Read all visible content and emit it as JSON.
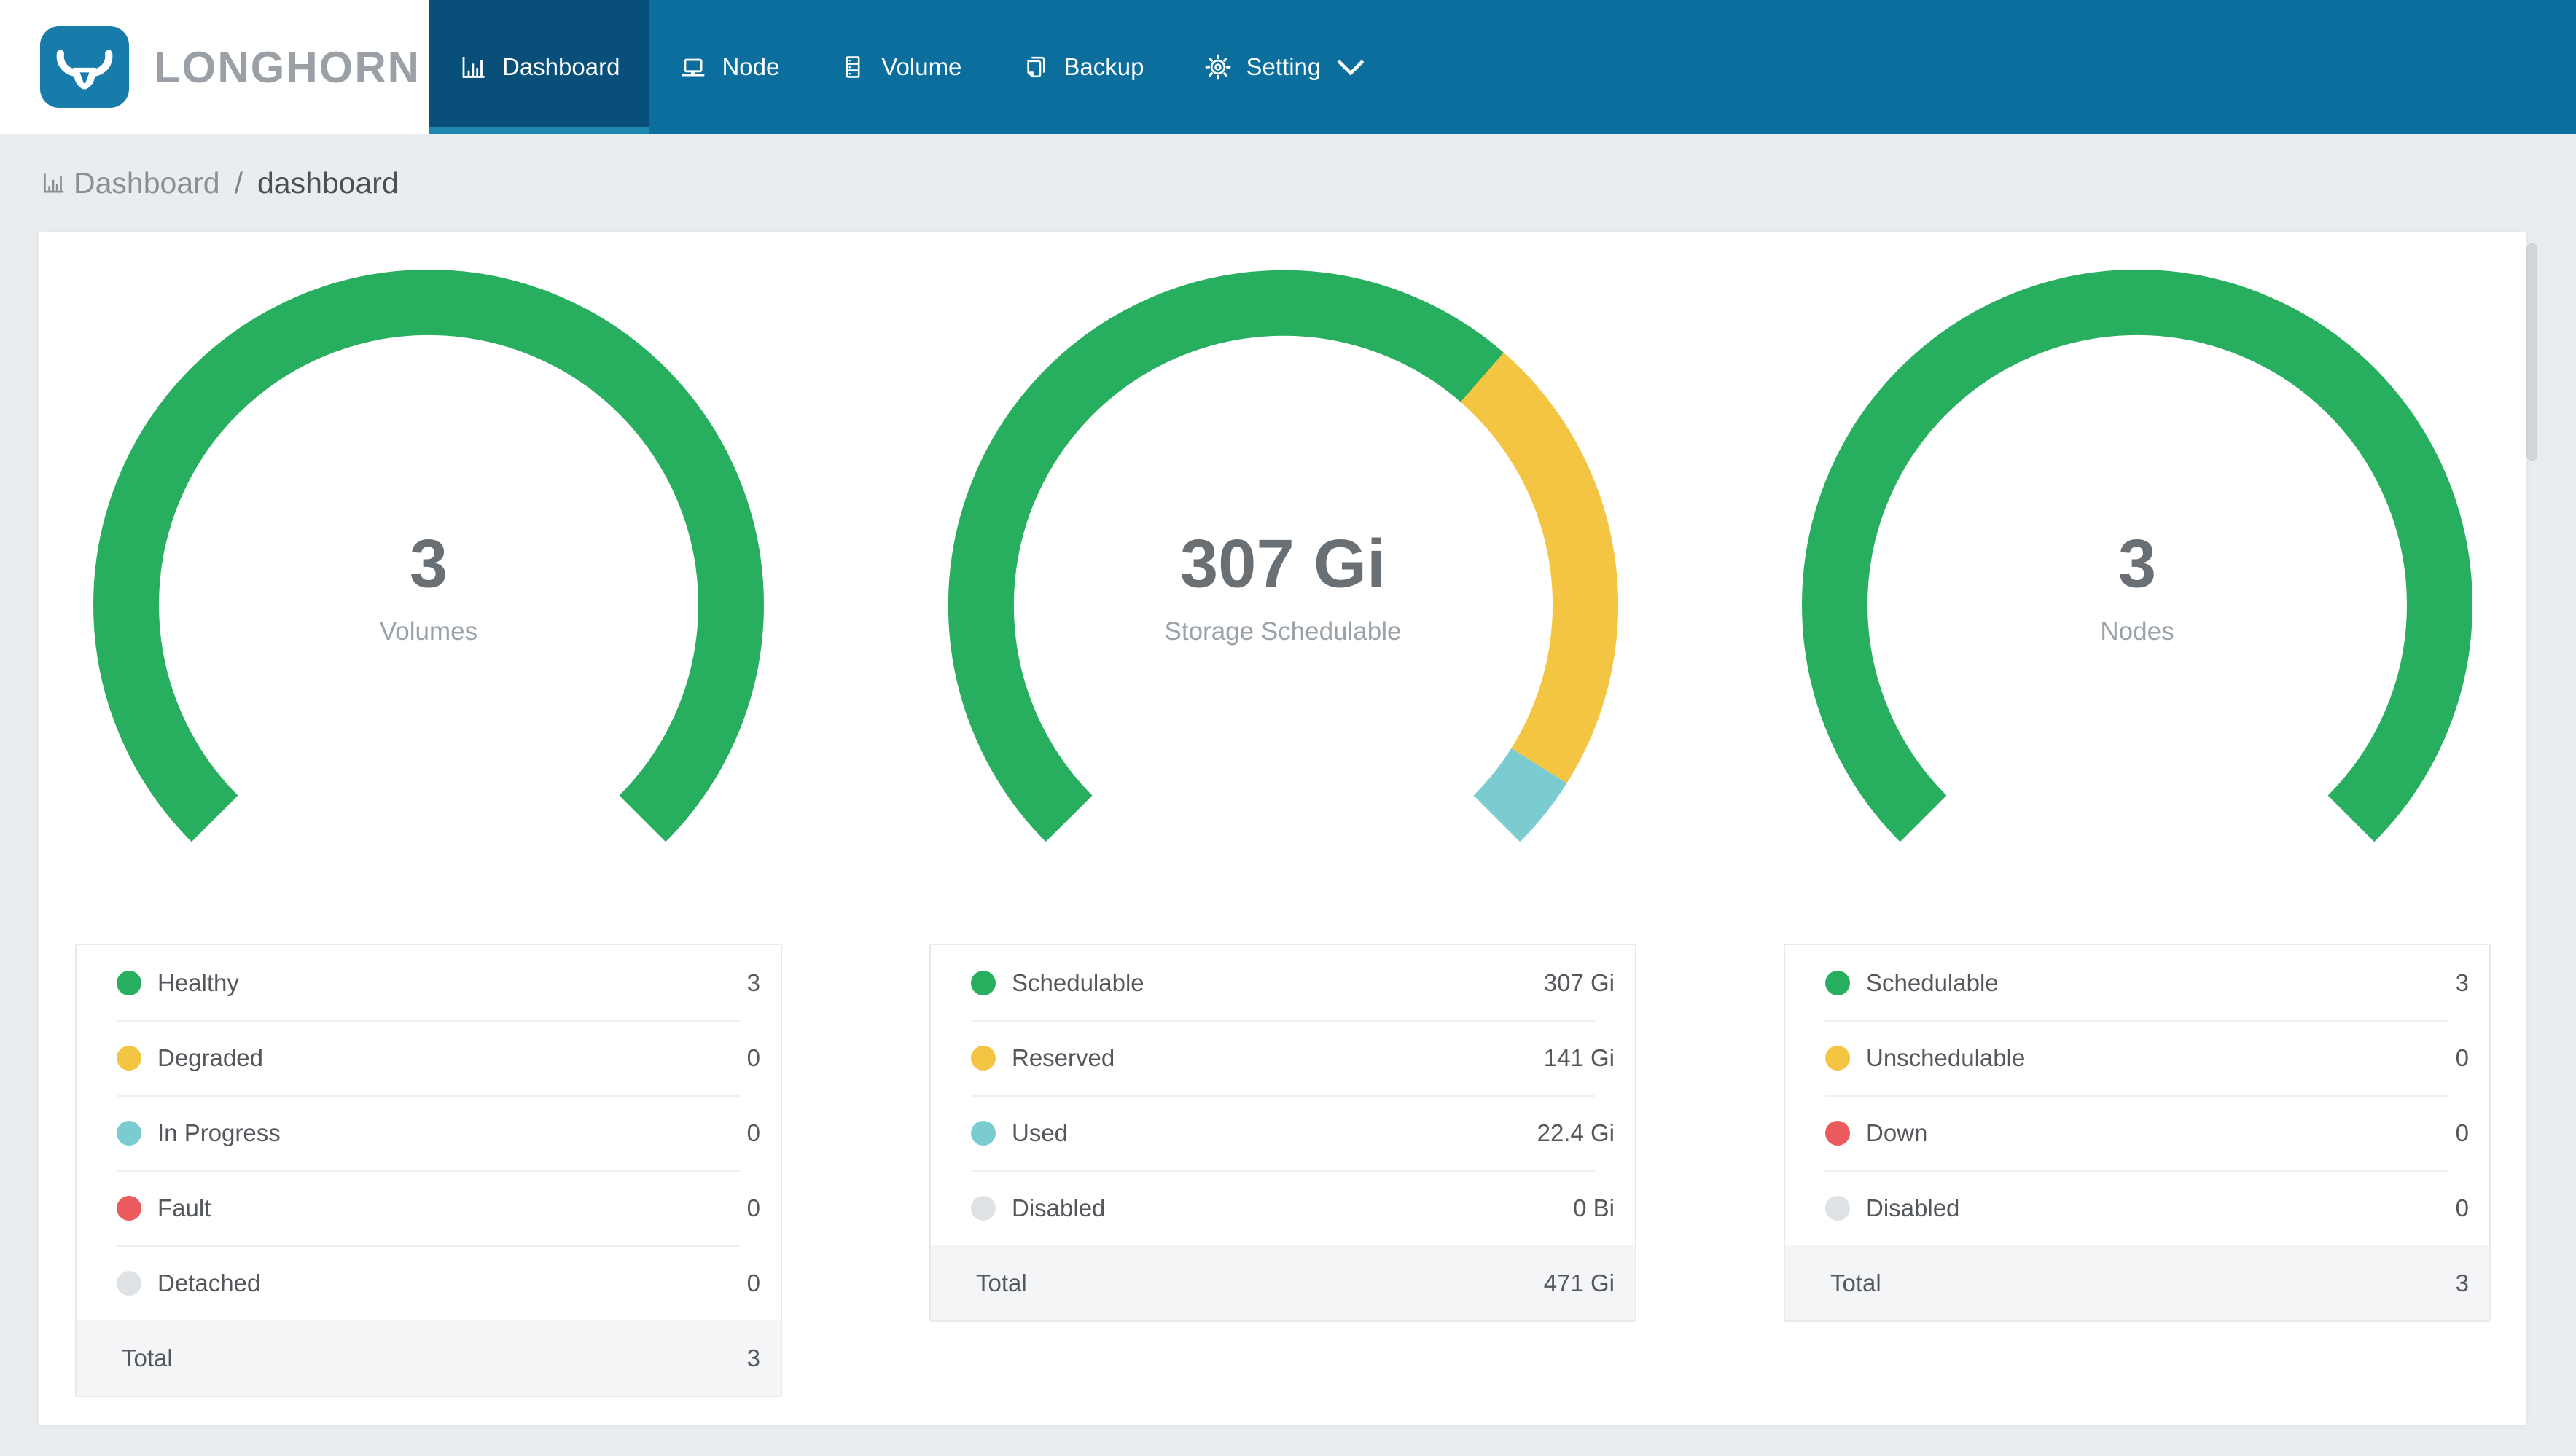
{
  "theme": {
    "nav_bg": "#0c6e9d",
    "nav_active_bg": "#085079",
    "nav_underline": "#1d89b2",
    "logo_blue": "#177ca9",
    "brand_gray": "#9aa0a5",
    "page_bg": "#e9edef"
  },
  "nav": {
    "brand": "LONGHORN",
    "items": [
      {
        "label": "Dashboard",
        "icon": "bar-chart-icon",
        "active": true
      },
      {
        "label": "Node",
        "icon": "laptop-icon",
        "active": false
      },
      {
        "label": "Volume",
        "icon": "server-stack-icon",
        "active": false
      },
      {
        "label": "Backup",
        "icon": "copy-file-icon",
        "active": false
      },
      {
        "label": "Setting",
        "icon": "gear-icon",
        "active": false,
        "has_dropdown": true
      }
    ]
  },
  "breadcrumb": {
    "icon": "bar-chart-icon",
    "section": "Dashboard",
    "separator": "/",
    "page": "dashboard"
  },
  "chart_data": [
    {
      "type": "gauge-donut",
      "title": "Volumes",
      "arc_degrees": 270,
      "center_value": "3",
      "center_label": "Volumes",
      "segments": [
        {
          "label": "Healthy",
          "value": 3,
          "display": "3",
          "color": "#27ae5e"
        },
        {
          "label": "Degraded",
          "value": 0,
          "display": "0",
          "color": "#f4c542"
        },
        {
          "label": "In Progress",
          "value": 0,
          "display": "0",
          "color": "#7accd1"
        },
        {
          "label": "Fault",
          "value": 0,
          "display": "0",
          "color": "#eb5a5c"
        },
        {
          "label": "Detached",
          "value": 0,
          "display": "0",
          "color": "#dfe2e5"
        }
      ],
      "total_label": "Total",
      "total_value": "3"
    },
    {
      "type": "gauge-donut",
      "title": "Storage Schedulable",
      "arc_degrees": 270,
      "center_value": "307 Gi",
      "center_label": "Storage Schedulable",
      "segments": [
        {
          "label": "Schedulable",
          "value": 307,
          "display": "307 Gi",
          "color": "#27ae5e"
        },
        {
          "label": "Reserved",
          "value": 141,
          "display": "141 Gi",
          "color": "#f4c542"
        },
        {
          "label": "Used",
          "value": 22.4,
          "display": "22.4 Gi",
          "color": "#7accd1"
        },
        {
          "label": "Disabled",
          "value": 0,
          "display": "0 Bi",
          "color": "#dfe2e5"
        }
      ],
      "total_label": "Total",
      "total_value": "471 Gi"
    },
    {
      "type": "gauge-donut",
      "title": "Nodes",
      "arc_degrees": 270,
      "center_value": "3",
      "center_label": "Nodes",
      "segments": [
        {
          "label": "Schedulable",
          "value": 3,
          "display": "3",
          "color": "#27ae5e"
        },
        {
          "label": "Unschedulable",
          "value": 0,
          "display": "0",
          "color": "#f4c542"
        },
        {
          "label": "Down",
          "value": 0,
          "display": "0",
          "color": "#eb5a5c"
        },
        {
          "label": "Disabled",
          "value": 0,
          "display": "0",
          "color": "#dfe2e5"
        }
      ],
      "total_label": "Total",
      "total_value": "3"
    }
  ]
}
